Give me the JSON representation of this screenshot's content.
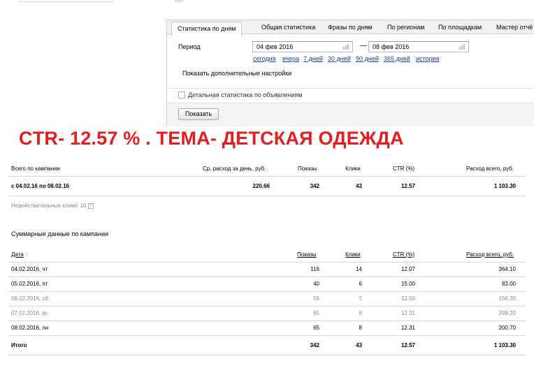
{
  "tabs": [
    {
      "label": "Статистика по дням",
      "active": true
    },
    {
      "label": "Общая статистика"
    },
    {
      "label": "Фразы по дням"
    },
    {
      "label": "По регионам"
    },
    {
      "label": "По площадкам"
    },
    {
      "label": "Мастер отчё"
    }
  ],
  "period": {
    "label": "Период",
    "from": "04 фев 2016",
    "to": "08 фев 2016",
    "separator": "—",
    "quick_links": [
      "сегодня",
      "вчера",
      "7 дней",
      "30 дней",
      "90 дней",
      "365 дней",
      "история"
    ]
  },
  "more_settings": "Показать дополнительные настройки",
  "detail_checkbox": {
    "label": "Детальная статистика по объявлениям",
    "checked": false
  },
  "show_button": "Показать",
  "headline": {
    "text": "CTR- 12.57 % . ТЕМА- ДЕТСКАЯ ОДЕЖДА",
    "color": "#e41e1e"
  },
  "campaign_totals": {
    "headers": [
      "Всего по кампании",
      "Ср. расход за день, руб.",
      "Показы",
      "Клики",
      "CTR (%)",
      "Расход всего, руб."
    ],
    "row": [
      "с 04.02.16 по 08.02.16",
      "220.66",
      "342",
      "43",
      "12.57",
      "1 103.30"
    ]
  },
  "invalid_clicks": "Недействительные клики: 10",
  "invalid_help_icon": "question-icon",
  "summary": {
    "title": "Суммарные данные по кампании",
    "headers": [
      "Дата",
      "Показы",
      "Клики",
      "CTR (%)",
      "Расход всего, руб."
    ],
    "sort_indicator": "↑",
    "rows": [
      {
        "date": "04.02.2016, чт",
        "shows": "116",
        "clicks": "14",
        "ctr": "12.07",
        "cost": "364.10",
        "weekend": false
      },
      {
        "date": "05.02.2016, пт",
        "shows": "40",
        "clicks": "6",
        "ctr": "15.00",
        "cost": "83.00",
        "weekend": false
      },
      {
        "date": "06.02.2016, сб",
        "shows": "56",
        "clicks": "7",
        "ctr": "12.50",
        "cost": "156.30",
        "weekend": true
      },
      {
        "date": "07.02.2016, вс",
        "shows": "65",
        "clicks": "8",
        "ctr": "12.31",
        "cost": "299.20",
        "weekend": true
      },
      {
        "date": "08.02.2016, пн",
        "shows": "65",
        "clicks": "8",
        "ctr": "12.31",
        "cost": "200.70",
        "weekend": false
      }
    ],
    "total": {
      "label": "Итого",
      "shows": "342",
      "clicks": "43",
      "ctr": "12.57",
      "cost": "1 103.30"
    }
  }
}
